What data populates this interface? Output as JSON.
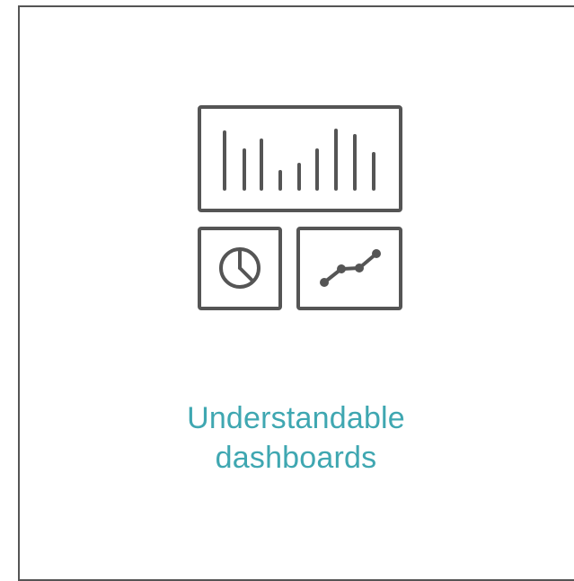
{
  "feature": {
    "icon": "dashboard-icon",
    "title_line1": "Understandable",
    "title_line2": "dashboards",
    "colors": {
      "title": "#3fa7b1",
      "icon_stroke": "#555555",
      "border": "#555555"
    }
  }
}
